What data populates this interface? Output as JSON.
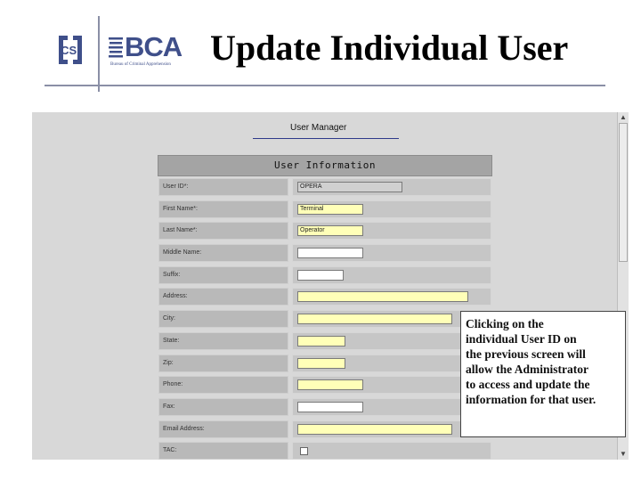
{
  "slide": {
    "title": "Update Individual User",
    "logos": {
      "csi": "CSI",
      "bca": "BCA",
      "bca_sub": "Bureau of Criminal Apprehension"
    }
  },
  "app": {
    "page_title": "User Manager",
    "form_title": "User Information",
    "fields": [
      {
        "label": "User ID*:",
        "value": "OPERA",
        "style": "grey",
        "input_w": 118
      },
      {
        "label": "First Name*:",
        "value": "Terminal",
        "style": "yellow",
        "input_w": 74
      },
      {
        "label": "Last Name*:",
        "value": "Operator",
        "style": "yellow",
        "input_w": 74
      },
      {
        "label": "Middle Name:",
        "value": "",
        "style": "white",
        "input_w": 74
      },
      {
        "label": "Suffix:",
        "value": "",
        "style": "white",
        "input_w": 52
      },
      {
        "label": "Address:",
        "value": "",
        "style": "yellow",
        "input_w": 192
      },
      {
        "label": "City:",
        "value": "",
        "style": "yellow",
        "input_w": 174
      },
      {
        "label": "State:",
        "value": "",
        "style": "yellow",
        "input_w": 54
      },
      {
        "label": "Zip:",
        "value": "",
        "style": "yellow",
        "input_w": 54
      },
      {
        "label": "Phone:",
        "value": "",
        "style": "yellow",
        "input_w": 74
      },
      {
        "label": "Fax:",
        "value": "",
        "style": "white",
        "input_w": 74
      },
      {
        "label": "Email Address:",
        "value": "",
        "style": "yellow",
        "input_w": 174
      },
      {
        "label": "TAC:",
        "value": "",
        "style": "checkbox",
        "input_w": 0
      }
    ]
  },
  "callout": {
    "lines": [
      "Clicking on the",
      "individual User ID on",
      "the previous screen will",
      "allow the Administrator",
      "to access and update the",
      "information for that user."
    ]
  },
  "colors": {
    "header_rule": "#8a8fa6",
    "logo_blue": "#3f4f8a",
    "input_yellow": "#ffffb8",
    "panel_bg": "#d8d8d8"
  }
}
